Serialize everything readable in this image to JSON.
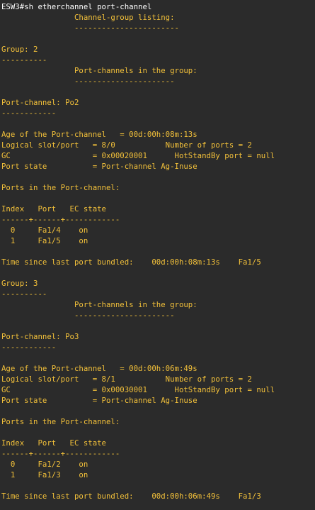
{
  "terminal": {
    "colors": {
      "background": "#2b2b2b",
      "output_text": "#f2c03a",
      "prompt_text": "#ffffff"
    },
    "lines": [
      {
        "kind": "prompt",
        "text": "ESW3#sh etherchannel port-channel"
      },
      {
        "kind": "output",
        "text": "                Channel-group listing:"
      },
      {
        "kind": "output",
        "text": "                -----------------------"
      },
      {
        "kind": "output",
        "text": ""
      },
      {
        "kind": "output",
        "text": "Group: 2"
      },
      {
        "kind": "output",
        "text": "----------"
      },
      {
        "kind": "output",
        "text": "                Port-channels in the group:"
      },
      {
        "kind": "output",
        "text": "                ----------------------"
      },
      {
        "kind": "output",
        "text": ""
      },
      {
        "kind": "output",
        "text": "Port-channel: Po2"
      },
      {
        "kind": "output",
        "text": "------------"
      },
      {
        "kind": "output",
        "text": ""
      },
      {
        "kind": "output",
        "text": "Age of the Port-channel   = 00d:00h:08m:13s"
      },
      {
        "kind": "output",
        "text": "Logical slot/port   = 8/0           Number of ports = 2"
      },
      {
        "kind": "output",
        "text": "GC                  = 0x00020001      HotStandBy port = null"
      },
      {
        "kind": "output",
        "text": "Port state          = Port-channel Ag-Inuse"
      },
      {
        "kind": "output",
        "text": ""
      },
      {
        "kind": "output",
        "text": "Ports in the Port-channel:"
      },
      {
        "kind": "output",
        "text": ""
      },
      {
        "kind": "output",
        "text": "Index   Port   EC state"
      },
      {
        "kind": "output",
        "text": "------+------+------------"
      },
      {
        "kind": "output",
        "text": "  0     Fa1/4    on"
      },
      {
        "kind": "output",
        "text": "  1     Fa1/5    on"
      },
      {
        "kind": "output",
        "text": ""
      },
      {
        "kind": "output",
        "text": "Time since last port bundled:    00d:00h:08m:13s    Fa1/5"
      },
      {
        "kind": "output",
        "text": ""
      },
      {
        "kind": "output",
        "text": "Group: 3"
      },
      {
        "kind": "output",
        "text": "----------"
      },
      {
        "kind": "output",
        "text": "                Port-channels in the group:"
      },
      {
        "kind": "output",
        "text": "                ----------------------"
      },
      {
        "kind": "output",
        "text": ""
      },
      {
        "kind": "output",
        "text": "Port-channel: Po3"
      },
      {
        "kind": "output",
        "text": "------------"
      },
      {
        "kind": "output",
        "text": ""
      },
      {
        "kind": "output",
        "text": "Age of the Port-channel   = 00d:00h:06m:49s"
      },
      {
        "kind": "output",
        "text": "Logical slot/port   = 8/1           Number of ports = 2"
      },
      {
        "kind": "output",
        "text": "GC                  = 0x00030001      HotStandBy port = null"
      },
      {
        "kind": "output",
        "text": "Port state          = Port-channel Ag-Inuse"
      },
      {
        "kind": "output",
        "text": ""
      },
      {
        "kind": "output",
        "text": "Ports in the Port-channel:"
      },
      {
        "kind": "output",
        "text": ""
      },
      {
        "kind": "output",
        "text": "Index   Port   EC state"
      },
      {
        "kind": "output",
        "text": "------+------+------------"
      },
      {
        "kind": "output",
        "text": "  0     Fa1/2    on"
      },
      {
        "kind": "output",
        "text": "  1     Fa1/3    on"
      },
      {
        "kind": "output",
        "text": ""
      },
      {
        "kind": "output",
        "text": "Time since last port bundled:    00d:00h:06m:49s    Fa1/3"
      }
    ]
  }
}
